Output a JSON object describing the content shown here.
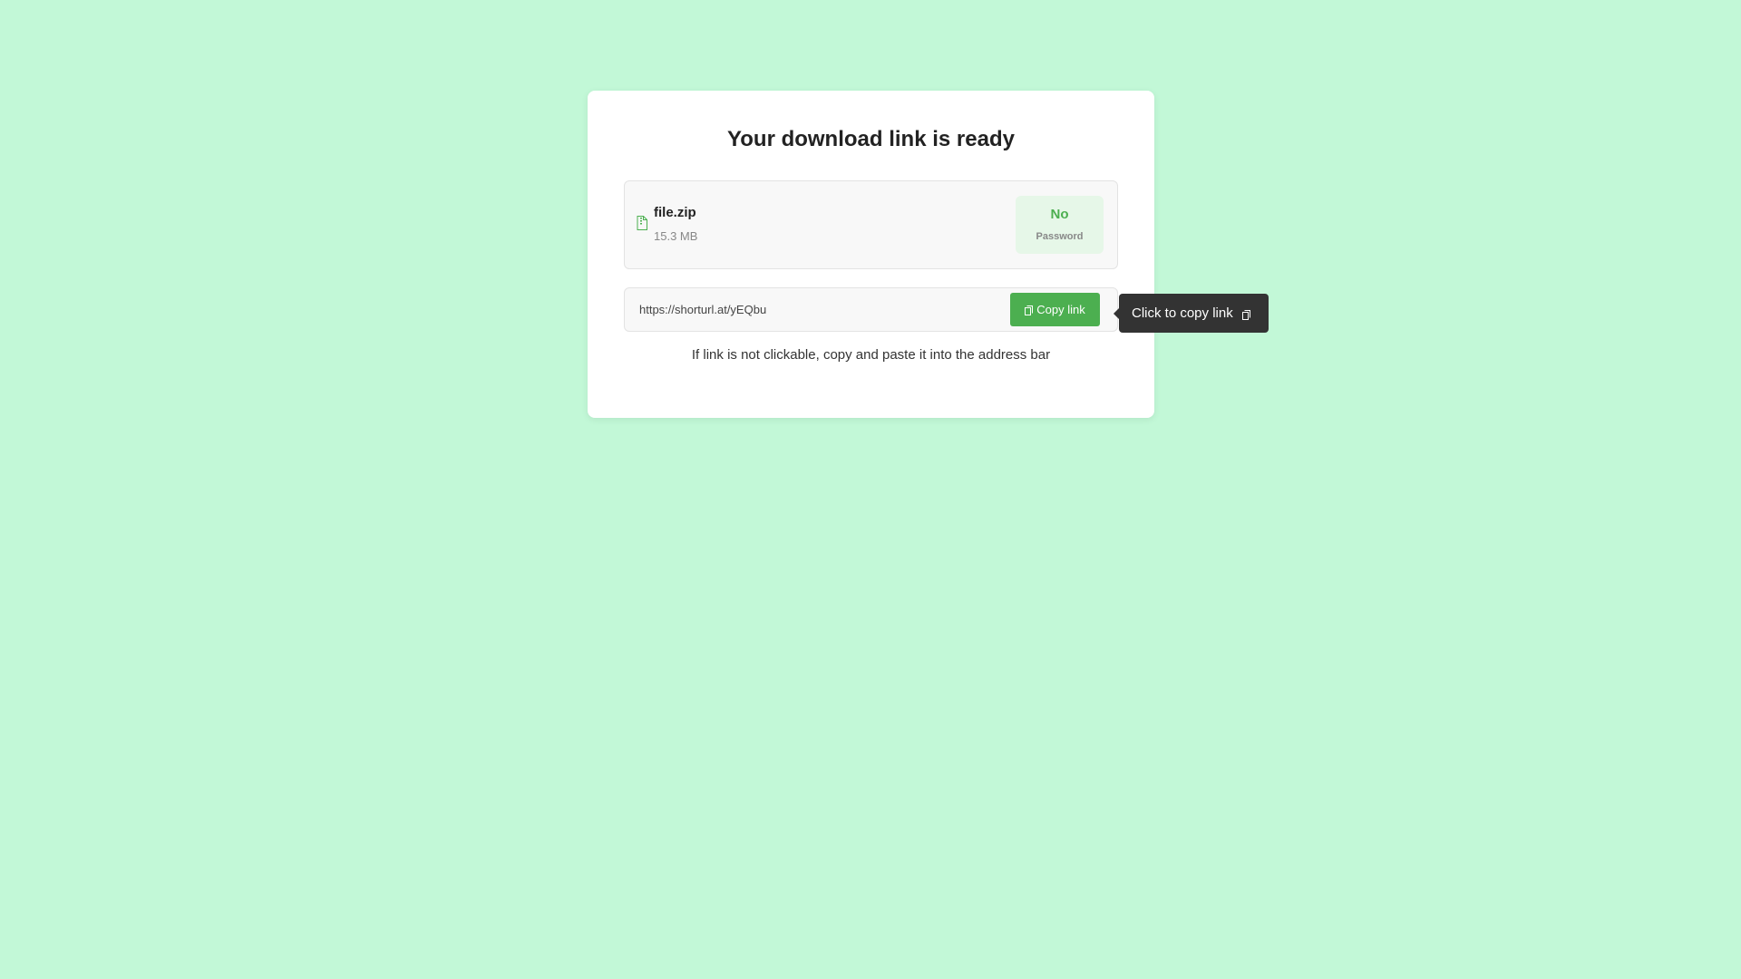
{
  "card": {
    "title": "Your download link is ready"
  },
  "file": {
    "icon": "file-archive-icon",
    "name": "file.zip",
    "size": "15.3 MB"
  },
  "password_badge": {
    "value": "No",
    "label": "Password"
  },
  "link": {
    "url": "https://shorturl.at/yEQbu",
    "copy_icon": "copy-icon",
    "copy_label": "Copy link"
  },
  "hint": "If link is not clickable, copy and paste it into the address bar",
  "tooltip": {
    "text": "Click to copy link",
    "icon": "copy-icon"
  },
  "colors": {
    "background": "#c2f8d7",
    "accent": "#4caf50",
    "tooltip": "#333333"
  }
}
